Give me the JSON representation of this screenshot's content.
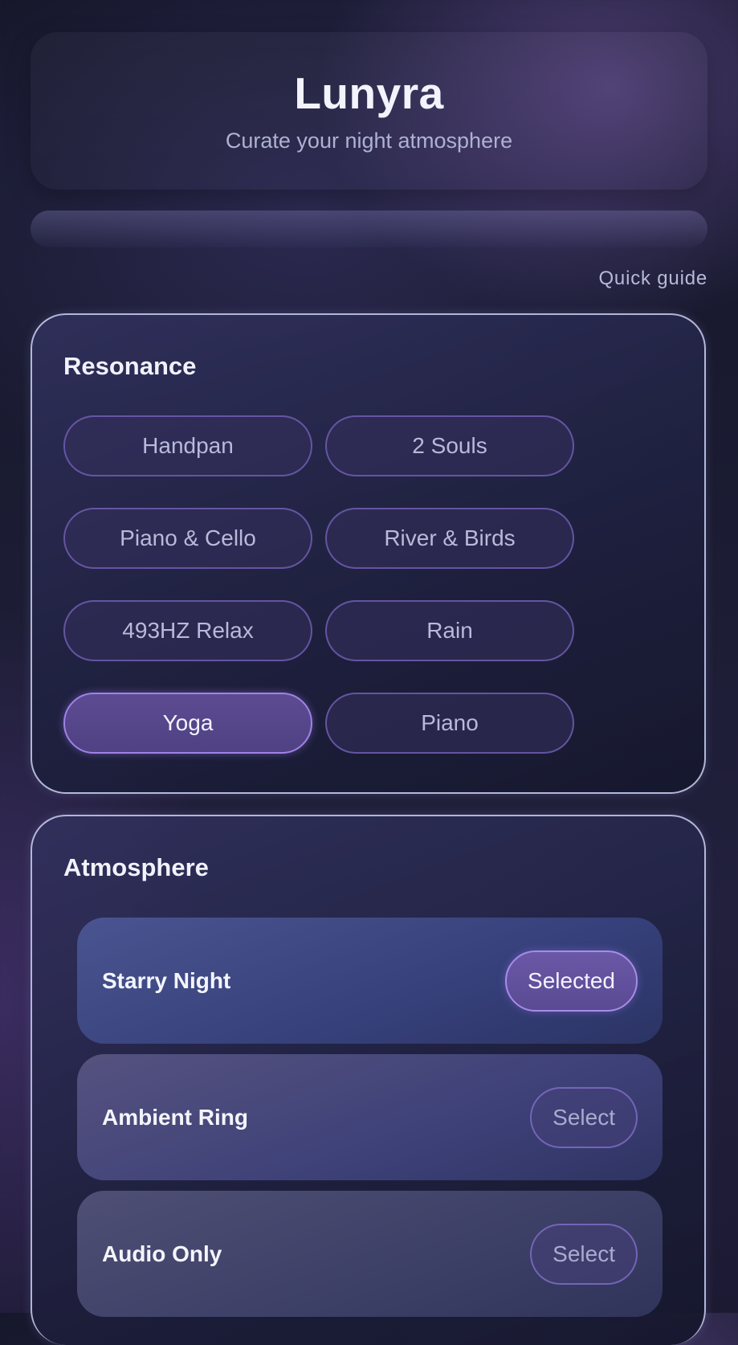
{
  "app": {
    "title": "Lunyra",
    "subtitle": "Curate your night atmosphere"
  },
  "progress": {
    "fraction": 0.0
  },
  "quick_guide_label": "Quick guide",
  "resonance": {
    "title": "Resonance",
    "chips": [
      {
        "label": "Handpan",
        "active": false
      },
      {
        "label": "2 Souls",
        "active": false
      },
      {
        "label": "Piano & Cello",
        "active": false
      },
      {
        "label": "River & Birds",
        "active": false
      },
      {
        "label": "493HZ Relax",
        "active": false
      },
      {
        "label": "Rain",
        "active": false
      },
      {
        "label": "Yoga",
        "active": true
      },
      {
        "label": "Piano",
        "active": false
      }
    ]
  },
  "atmosphere": {
    "title": "Atmosphere",
    "items": [
      {
        "label": "Starry Night",
        "button": "Selected",
        "selected": true
      },
      {
        "label": "Ambient Ring",
        "button": "Select",
        "selected": false
      },
      {
        "label": "Audio Only",
        "button": "Select",
        "selected": false
      }
    ]
  },
  "colors": {
    "accent": "#9f82e6",
    "panel_border": "#cdd2f5",
    "background": "#1b1c33"
  }
}
